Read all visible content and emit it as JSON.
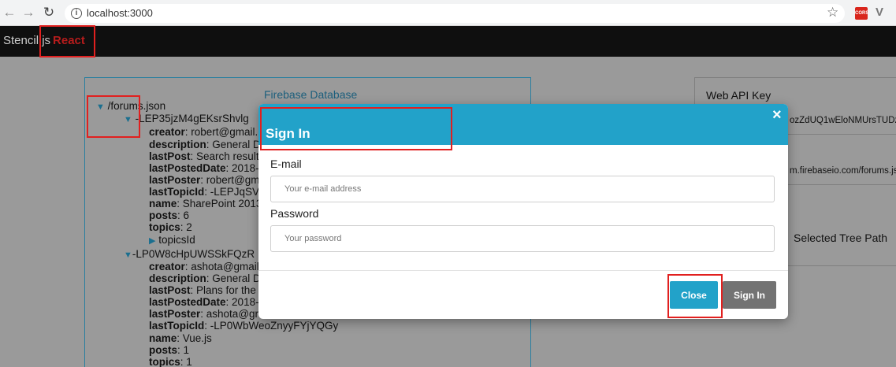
{
  "browser": {
    "url": "localhost:3000",
    "back_icon": "back-arrow-icon",
    "forward_icon": "forward-arrow-icon",
    "reload_icon": "reload-icon",
    "extension_cors_label": "CORS"
  },
  "navbar": {
    "brand_main": "Stencil.js",
    "brand_accent": "React"
  },
  "db_panel": {
    "title": "Firebase Database",
    "root": "/forums.json",
    "node1": {
      "key": "-LEP35jzM4gEKsrShvlg",
      "fields": [
        {
          "k": "creator",
          "v": ": robert@gmail."
        },
        {
          "k": "description",
          "v": ": General D"
        },
        {
          "k": "lastPost",
          "v": ": Search result"
        },
        {
          "k": "lastPostedDate",
          "v": ": 2018-"
        },
        {
          "k": "lastPoster",
          "v": ": robert@gm"
        },
        {
          "k": "lastTopicId",
          "v": ": -LEPJqSV"
        },
        {
          "k": "name",
          "v": ": SharePoint 2013"
        },
        {
          "k": "posts",
          "v": ": 6"
        },
        {
          "k": "topics",
          "v": ": 2"
        }
      ],
      "child": "topicsId"
    },
    "node2": {
      "key": "-LP0W8cHpUWSSkFQzR",
      "fields": [
        {
          "k": "creator",
          "v": ": ashota@gmail"
        },
        {
          "k": "description",
          "v": ": General D"
        },
        {
          "k": "lastPost",
          "v": ": Plans for the"
        },
        {
          "k": "lastPostedDate",
          "v": ": 2018-"
        },
        {
          "k": "lastPoster",
          "v": ": ashota@gr"
        },
        {
          "k": "lastTopicId",
          "v": ": -LP0WbWeoZnyyFYjYQGy"
        },
        {
          "k": "name",
          "v": ": Vue.js"
        },
        {
          "k": "posts",
          "v": ": 1"
        },
        {
          "k": "topics",
          "v": ": 1"
        }
      ]
    }
  },
  "right_panel": {
    "api_key_label": "Web API Key",
    "api_key_value": "ozZdUQ1wEloNMUrsTUDz",
    "url_value": "m.firebaseio.com/forums.jsc",
    "selected_tree_path_button": "Selected Tree Path"
  },
  "modal": {
    "title": "Sign In",
    "email_label": "E-mail",
    "email_placeholder": "Your e-mail address",
    "password_label": "Password",
    "password_placeholder": "Your password",
    "close_button": "Close",
    "signin_button": "Sign In",
    "close_icon": "×"
  },
  "colors": {
    "accent": "#22a2c9",
    "navbar": "#0f0f0f",
    "overlay": "#9a9a9a",
    "highlight_box": "#e1201f",
    "brand_accent": "#b71c1c",
    "secondary_button": "#737373"
  }
}
